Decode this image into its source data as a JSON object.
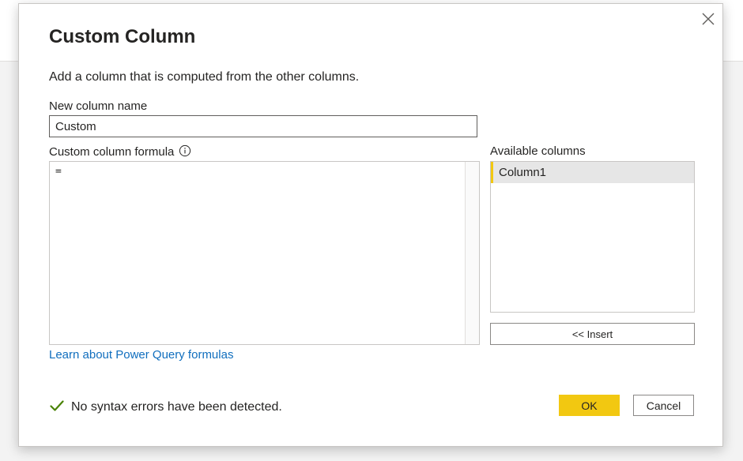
{
  "dialog": {
    "title": "Custom Column",
    "subtitle": "Add a column that is computed from the other columns.",
    "close_icon": "close-icon"
  },
  "new_column": {
    "label": "New column name",
    "value": "Custom"
  },
  "formula": {
    "label": "Custom column formula",
    "info_icon": "info-icon",
    "value": "="
  },
  "available_columns": {
    "label": "Available columns",
    "items": [
      "Column1"
    ],
    "selected_accent": "#f2c811"
  },
  "insert_button": {
    "label": "<< Insert"
  },
  "learn_link": {
    "text": "Learn about Power Query formulas"
  },
  "status": {
    "icon": "checkmark-icon",
    "text": "No syntax errors have been detected.",
    "color": "#498205"
  },
  "buttons": {
    "ok_label": "OK",
    "cancel_label": "Cancel",
    "ok_color": "#f2c811"
  }
}
